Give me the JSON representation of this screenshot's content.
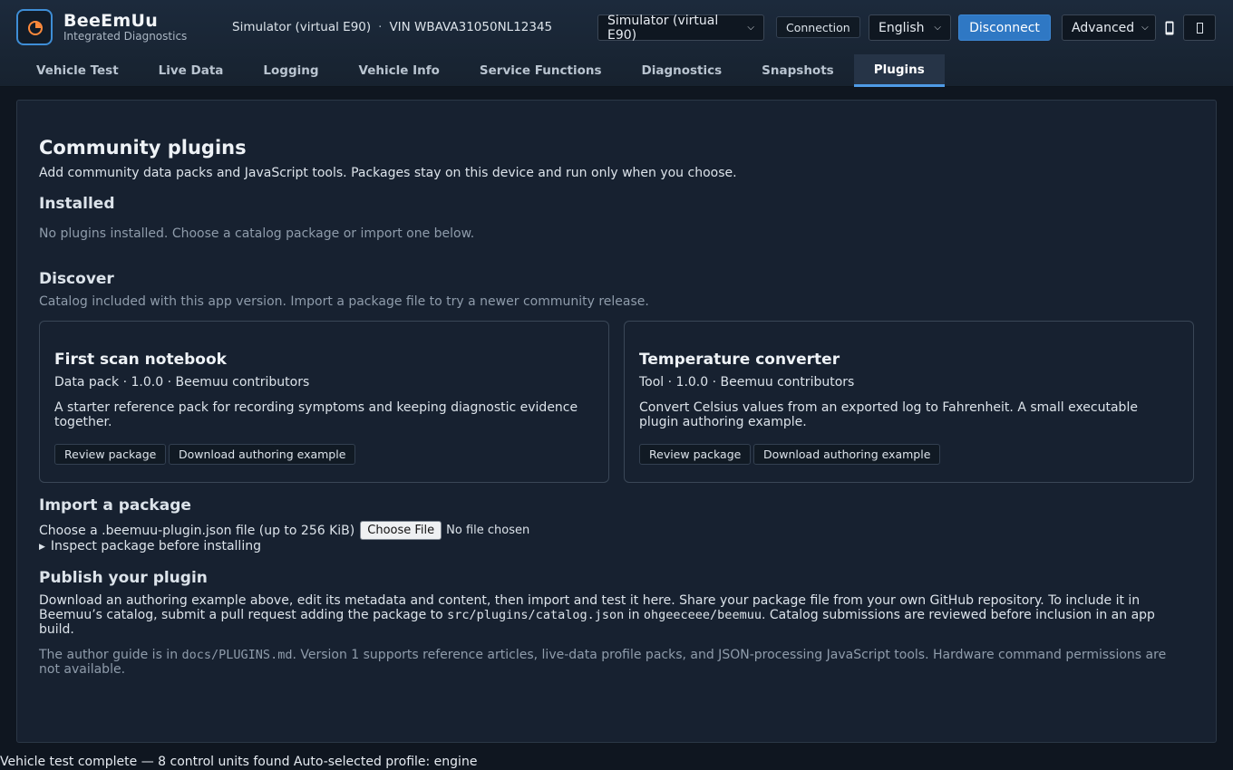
{
  "app": {
    "name": "BeeEmUu",
    "subtitle": "Integrated Diagnostics",
    "logo_icon": "gauge-icon",
    "accent_color": "#3e8ed6"
  },
  "header": {
    "vehicle_name": "Simulator (virtual E90)",
    "separator": "·",
    "vin": "VIN WBAVA31050NL12345",
    "adapter_select": "Simulator (virtual E90)",
    "connection_label": "Connection",
    "language_select": "English",
    "disconnect_label": "Disconnect",
    "mode_select": "Advanced",
    "disconnect_color": "#2f78c4"
  },
  "tabs": [
    {
      "label": "Vehicle Test"
    },
    {
      "label": "Live Data"
    },
    {
      "label": "Logging"
    },
    {
      "label": "Vehicle Info"
    },
    {
      "label": "Service Functions"
    },
    {
      "label": "Diagnostics"
    },
    {
      "label": "Snapshots"
    },
    {
      "label": "Plugins",
      "active": true
    }
  ],
  "plugins": {
    "title": "Community plugins",
    "intro": "Add community data packs and JavaScript tools. Packages stay on this device and run only when you choose.",
    "installed": {
      "heading": "Installed",
      "empty_text": "No plugins installed. Choose a catalog package or import one below."
    },
    "discover": {
      "heading": "Discover",
      "note": "Catalog included with this app version. Import a package file to try a newer community release.",
      "cards": [
        {
          "title": "First scan notebook",
          "meta": "Data pack · 1.0.0 · Beemuu contributors",
          "description": "A starter reference pack for recording symptoms and keeping diagnostic evidence together.",
          "review_label": "Review package",
          "download_label": "Download authoring example"
        },
        {
          "title": "Temperature converter",
          "meta": "Tool · 1.0.0 · Beemuu contributors",
          "description": "Convert Celsius values from an exported log to Fahrenheit. A small executable plugin authoring example.",
          "review_label": "Review package",
          "download_label": "Download authoring example"
        }
      ]
    },
    "import": {
      "heading": "Import a package",
      "label": "Choose a .beemuu-plugin.json file (up to 256 KiB)",
      "file_button": "Choose File",
      "file_status": "No file chosen",
      "details_summary": "Inspect package before installing"
    },
    "publish": {
      "heading": "Publish your plugin",
      "body_1": "Download an authoring example above, edit its metadata and content, then import and test it here. Share your package file from your own GitHub repository. To include it in Beemuu’s catalog, submit a pull request adding the package to",
      "catalog_path": "src/plugins/catalog.json",
      "body_2": "in",
      "repo": "ohgeeceee/beemuu",
      "body_3": ". Catalog submissions are reviewed before inclusion in an app build.",
      "note_1": "The author guide is in",
      "guide_path": "docs/PLUGINS.md",
      "note_2": ". Version 1 supports reference articles, live-data profile packs, and JSON-processing JavaScript tools. Hardware command permissions are not available."
    }
  },
  "status_bar": {
    "text": "Vehicle test complete — 8 control units found Auto-selected profile: engine"
  }
}
